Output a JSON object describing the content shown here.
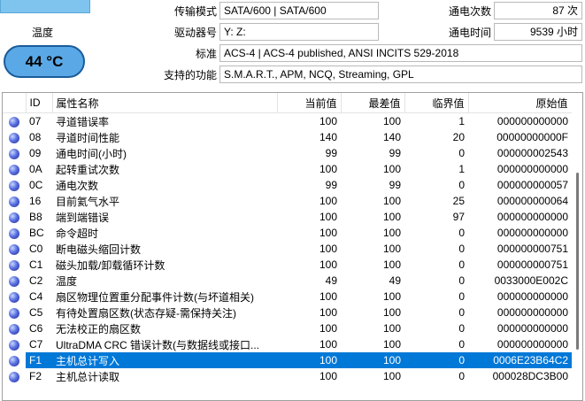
{
  "temperature": {
    "label": "温度",
    "value": "44 °C"
  },
  "info": {
    "transfer_mode_label": "传输模式",
    "transfer_mode": "SATA/600 | SATA/600",
    "drive_letter_label": "驱动器号",
    "drive_letter": "Y: Z:",
    "standard_label": "标准",
    "standard": "ACS-4 | ACS-4 published, ANSI INCITS 529-2018",
    "features_label": "支持的功能",
    "features": "S.M.A.R.T., APM, NCQ, Streaming, GPL",
    "power_count_label": "通电次数",
    "power_count": "87 次",
    "power_hours_label": "通电时间",
    "power_hours": "9539 小时"
  },
  "table": {
    "headers": [
      "ID",
      "属性名称",
      "当前值",
      "最差值",
      "临界值",
      "原始值"
    ],
    "rows": [
      {
        "id": "07",
        "name": "寻道错误率",
        "cur": "100",
        "worst": "100",
        "thr": "1",
        "raw": "000000000000"
      },
      {
        "id": "08",
        "name": "寻道时间性能",
        "cur": "140",
        "worst": "140",
        "thr": "20",
        "raw": "00000000000F"
      },
      {
        "id": "09",
        "name": "通电时间(小时)",
        "cur": "99",
        "worst": "99",
        "thr": "0",
        "raw": "000000002543"
      },
      {
        "id": "0A",
        "name": "起转重试次数",
        "cur": "100",
        "worst": "100",
        "thr": "1",
        "raw": "000000000000"
      },
      {
        "id": "0C",
        "name": "通电次数",
        "cur": "99",
        "worst": "99",
        "thr": "0",
        "raw": "000000000057"
      },
      {
        "id": "16",
        "name": "目前氦气水平",
        "cur": "100",
        "worst": "100",
        "thr": "25",
        "raw": "000000000064"
      },
      {
        "id": "B8",
        "name": "端到端错误",
        "cur": "100",
        "worst": "100",
        "thr": "97",
        "raw": "000000000000"
      },
      {
        "id": "BC",
        "name": "命令超时",
        "cur": "100",
        "worst": "100",
        "thr": "0",
        "raw": "000000000000"
      },
      {
        "id": "C0",
        "name": "断电磁头缩回计数",
        "cur": "100",
        "worst": "100",
        "thr": "0",
        "raw": "000000000751"
      },
      {
        "id": "C1",
        "name": "磁头加载/卸载循环计数",
        "cur": "100",
        "worst": "100",
        "thr": "0",
        "raw": "000000000751"
      },
      {
        "id": "C2",
        "name": "温度",
        "cur": "49",
        "worst": "49",
        "thr": "0",
        "raw": "0033000E002C"
      },
      {
        "id": "C4",
        "name": "扇区物理位置重分配事件计数(与坏道相关)",
        "cur": "100",
        "worst": "100",
        "thr": "0",
        "raw": "000000000000"
      },
      {
        "id": "C5",
        "name": "有待处置扇区数(状态存疑-需保持关注)",
        "cur": "100",
        "worst": "100",
        "thr": "0",
        "raw": "000000000000"
      },
      {
        "id": "C6",
        "name": "无法校正的扇区数",
        "cur": "100",
        "worst": "100",
        "thr": "0",
        "raw": "000000000000"
      },
      {
        "id": "C7",
        "name": "UltraDMA CRC 错误计数(与数据线或接口...",
        "cur": "100",
        "worst": "100",
        "thr": "0",
        "raw": "000000000000"
      },
      {
        "id": "F1",
        "name": "主机总计写入",
        "cur": "100",
        "worst": "100",
        "thr": "0",
        "raw": "0006E23B64C2"
      },
      {
        "id": "F2",
        "name": "主机总计读取",
        "cur": "100",
        "worst": "100",
        "thr": "0",
        "raw": "000028DC3B00"
      }
    ],
    "selected_id": "F1"
  }
}
